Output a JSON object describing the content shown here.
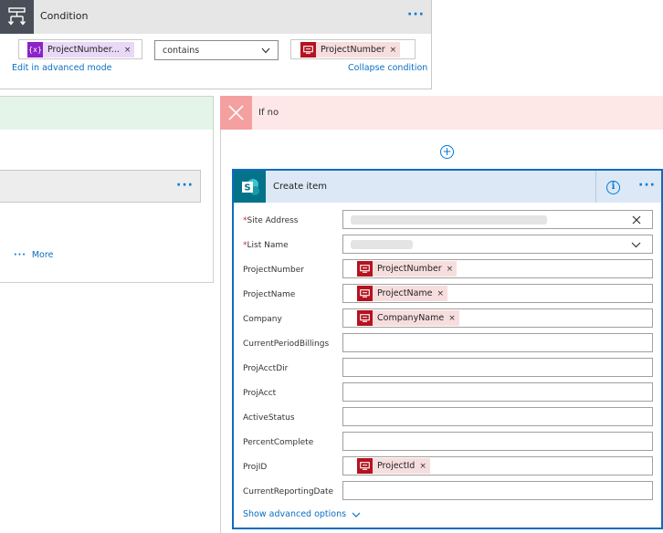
{
  "condition": {
    "title": "Condition",
    "left_token": "ProjectNumber...",
    "operator": "contains",
    "right_token": "ProjectNumber",
    "edit_link": "Edit in advanced mode",
    "collapse_link": "Collapse condition",
    "menu_glyph": "···"
  },
  "yes_branch": {
    "menu_glyph": "···",
    "more_link": "More",
    "more_glyph": "···"
  },
  "no_branch": {
    "title": "If no",
    "add_glyph": "+"
  },
  "create_item": {
    "title": "Create item",
    "info_glyph": "i",
    "menu_glyph": "···",
    "fields": [
      {
        "label": "Site Address",
        "required": "*",
        "value": ""
      },
      {
        "label": "List Name",
        "required": "*",
        "value": ""
      },
      {
        "label": "ProjectNumber",
        "token": "ProjectNumber"
      },
      {
        "label": "ProjectName",
        "token": "ProjectName"
      },
      {
        "label": "Company",
        "token": "CompanyName"
      },
      {
        "label": "CurrentPeriodBillings"
      },
      {
        "label": "ProjAcctDir"
      },
      {
        "label": "ProjAcct"
      },
      {
        "label": "ActiveStatus"
      },
      {
        "label": "PercentComplete"
      },
      {
        "label": "ProjID",
        "token": "ProjectId"
      },
      {
        "label": "CurrentReportingDate"
      }
    ],
    "advanced_link": "Show advanced options"
  },
  "token_close": "×",
  "icons": {
    "condition": "condition-flow-icon",
    "variable": "variable-icon",
    "dynamic_content": "dynamic-content-icon",
    "sharepoint": "sharepoint-icon",
    "close": "close-icon",
    "chevron": "chevron-down-icon"
  },
  "colors": {
    "accent": "#0078d7",
    "condition_header": "#e6e6e6",
    "yes_header": "#e5f4e8",
    "no_header": "#fde7e7",
    "token_red": "#b4131f",
    "token_purple": "#8c22c9",
    "sharepoint": "#04738a"
  }
}
